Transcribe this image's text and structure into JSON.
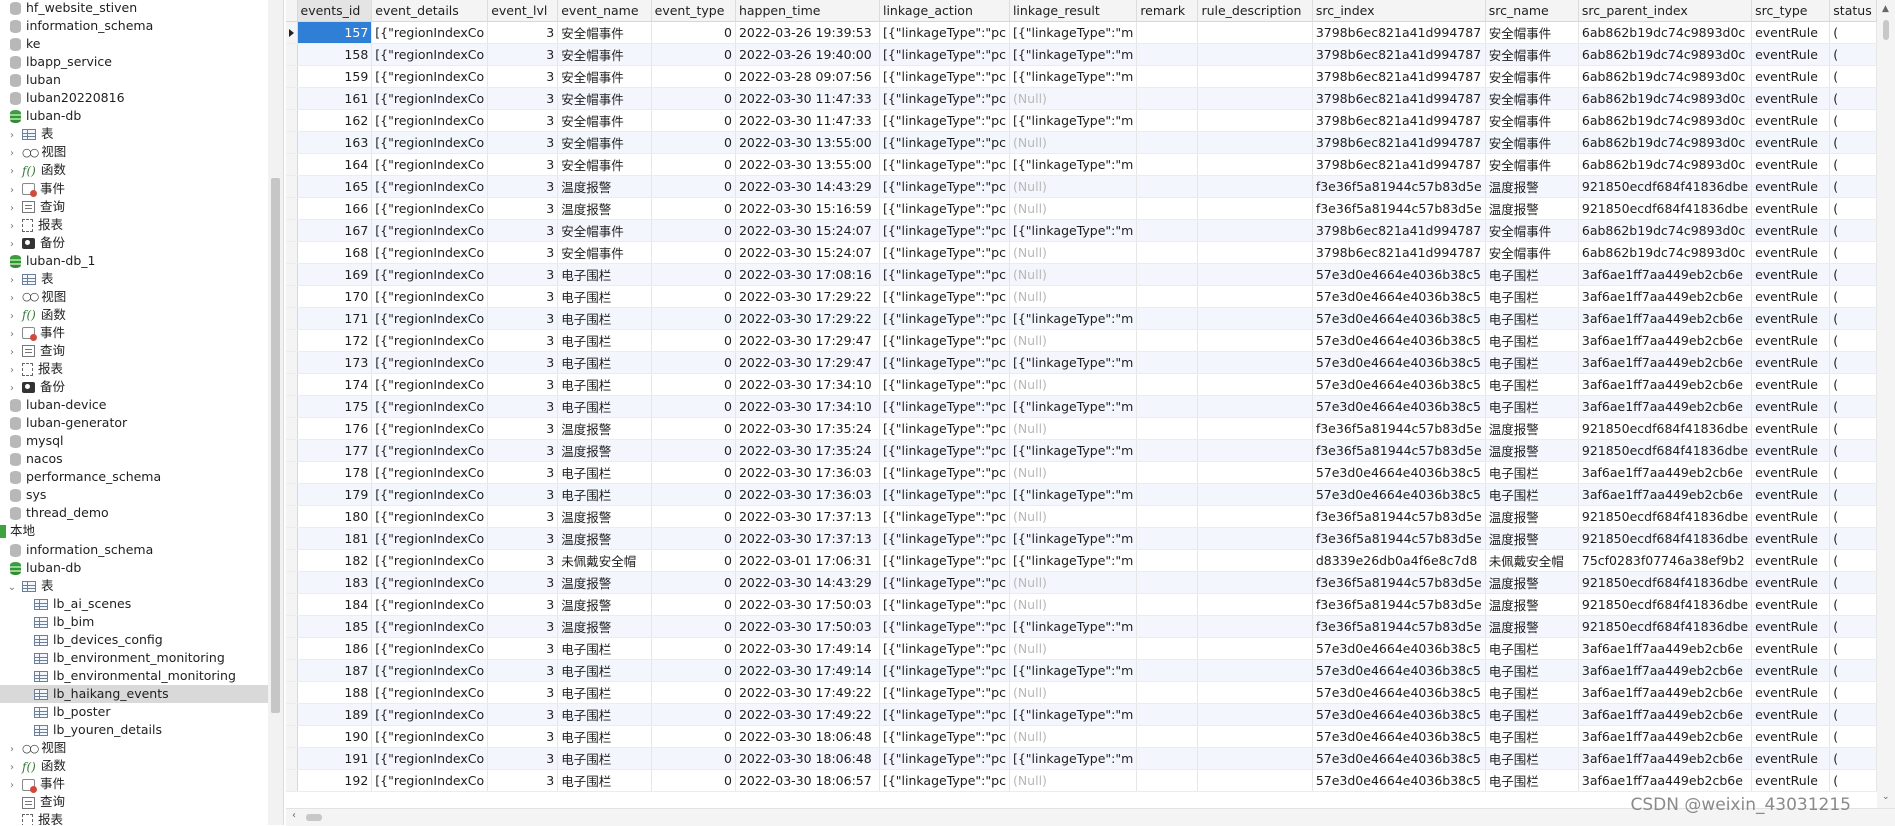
{
  "tree": [
    {
      "label": "hf_website_stiven",
      "icon": "db-gray",
      "depth": 1
    },
    {
      "label": "information_schema",
      "icon": "db-gray",
      "depth": 1
    },
    {
      "label": "ke",
      "icon": "db-gray",
      "depth": 1
    },
    {
      "label": "lbapp_service",
      "icon": "db-gray",
      "depth": 1
    },
    {
      "label": "luban",
      "icon": "db-gray",
      "depth": 1
    },
    {
      "label": "luban20220816",
      "icon": "db-gray",
      "depth": 1
    },
    {
      "label": "luban-db",
      "icon": "db",
      "depth": 1
    },
    {
      "label": "表",
      "icon": "tbl",
      "depth": 2,
      "twisty": "›"
    },
    {
      "label": "视图",
      "icon": "view",
      "depth": 2,
      "twisty": "›"
    },
    {
      "label": "函数",
      "icon": "fx",
      "depth": 2,
      "twisty": "›"
    },
    {
      "label": "事件",
      "icon": "evt",
      "depth": 2,
      "twisty": "›"
    },
    {
      "label": "查询",
      "icon": "qry",
      "depth": 2,
      "twisty": "›"
    },
    {
      "label": "报表",
      "icon": "rpt",
      "depth": 2,
      "twisty": "›"
    },
    {
      "label": "备份",
      "icon": "bak",
      "depth": 2,
      "twisty": "›"
    },
    {
      "label": "luban-db_1",
      "icon": "db",
      "depth": 1
    },
    {
      "label": "表",
      "icon": "tbl",
      "depth": 2,
      "twisty": "›"
    },
    {
      "label": "视图",
      "icon": "view",
      "depth": 2,
      "twisty": "›"
    },
    {
      "label": "函数",
      "icon": "fx",
      "depth": 2,
      "twisty": "›"
    },
    {
      "label": "事件",
      "icon": "evt",
      "depth": 2,
      "twisty": "›"
    },
    {
      "label": "查询",
      "icon": "qry",
      "depth": 2,
      "twisty": "›"
    },
    {
      "label": "报表",
      "icon": "rpt",
      "depth": 2,
      "twisty": "›"
    },
    {
      "label": "备份",
      "icon": "bak",
      "depth": 2,
      "twisty": "›"
    },
    {
      "label": "luban-device",
      "icon": "db-gray",
      "depth": 1
    },
    {
      "label": "luban-generator",
      "icon": "db-gray",
      "depth": 1
    },
    {
      "label": "mysql",
      "icon": "db-gray",
      "depth": 1
    },
    {
      "label": "nacos",
      "icon": "db-gray",
      "depth": 1
    },
    {
      "label": "performance_schema",
      "icon": "db-gray",
      "depth": 1
    },
    {
      "label": "sys",
      "icon": "db-gray",
      "depth": 1
    },
    {
      "label": "thread_demo",
      "icon": "db-gray",
      "depth": 1
    },
    {
      "label": "本地",
      "icon": "conn",
      "depth": 0
    },
    {
      "label": "information_schema",
      "icon": "db-gray",
      "depth": 1
    },
    {
      "label": "luban-db",
      "icon": "db",
      "depth": 1
    },
    {
      "label": "表",
      "icon": "tbl",
      "depth": 2,
      "twisty": "⌄"
    },
    {
      "label": "lb_ai_scenes",
      "icon": "tbl",
      "depth": 3
    },
    {
      "label": "lb_bim",
      "icon": "tbl",
      "depth": 3
    },
    {
      "label": "lb_devices_config",
      "icon": "tbl",
      "depth": 3
    },
    {
      "label": "lb_environment_monitoring",
      "icon": "tbl",
      "depth": 3
    },
    {
      "label": "lb_environmental_monitoring",
      "icon": "tbl",
      "depth": 3
    },
    {
      "label": "lb_haikang_events",
      "icon": "tbl",
      "depth": 3,
      "selected": true
    },
    {
      "label": "lb_poster",
      "icon": "tbl",
      "depth": 3
    },
    {
      "label": "lb_youren_details",
      "icon": "tbl",
      "depth": 3
    },
    {
      "label": "视图",
      "icon": "view",
      "depth": 2,
      "twisty": "›"
    },
    {
      "label": "函数",
      "icon": "fx",
      "depth": 2,
      "twisty": "›"
    },
    {
      "label": "事件",
      "icon": "evt",
      "depth": 2,
      "twisty": "›"
    },
    {
      "label": "查询",
      "icon": "qry",
      "depth": 2
    },
    {
      "label": "报表",
      "icon": "rpt",
      "depth": 2
    }
  ],
  "grid": {
    "columns": [
      "events_id",
      "event_details",
      "event_lvl",
      "event_name",
      "event_type",
      "happen_time",
      "linkage_action",
      "linkage_result",
      "remark",
      "rule_description",
      "src_index",
      "src_name",
      "src_parent_index",
      "src_type",
      "status"
    ],
    "rows": [
      [
        "157",
        "[{\"regionIndexCo",
        "3",
        "安全帽事件",
        "0",
        "2022-03-26 19:39:53",
        "[{\"linkageType\":\"pc",
        "[{\"linkageType\":\"m",
        "",
        "",
        "3798b6ec821a41d994787",
        "安全帽事件",
        "6ab862b19dc74c9893d0c",
        "eventRule",
        "("
      ],
      [
        "158",
        "[{\"regionIndexCo",
        "3",
        "安全帽事件",
        "0",
        "2022-03-26 19:40:00",
        "[{\"linkageType\":\"pc",
        "[{\"linkageType\":\"m",
        "",
        "",
        "3798b6ec821a41d994787",
        "安全帽事件",
        "6ab862b19dc74c9893d0c",
        "eventRule",
        "("
      ],
      [
        "159",
        "[{\"regionIndexCo",
        "3",
        "安全帽事件",
        "0",
        "2022-03-28 09:07:56",
        "[{\"linkageType\":\"pc",
        "[{\"linkageType\":\"m",
        "",
        "",
        "3798b6ec821a41d994787",
        "安全帽事件",
        "6ab862b19dc74c9893d0c",
        "eventRule",
        "("
      ],
      [
        "161",
        "[{\"regionIndexCo",
        "3",
        "安全帽事件",
        "0",
        "2022-03-30 11:47:33",
        "[{\"linkageType\":\"pc",
        "(Null)",
        "",
        "",
        "3798b6ec821a41d994787",
        "安全帽事件",
        "6ab862b19dc74c9893d0c",
        "eventRule",
        "("
      ],
      [
        "162",
        "[{\"regionIndexCo",
        "3",
        "安全帽事件",
        "0",
        "2022-03-30 11:47:33",
        "[{\"linkageType\":\"pc",
        "[{\"linkageType\":\"m",
        "",
        "",
        "3798b6ec821a41d994787",
        "安全帽事件",
        "6ab862b19dc74c9893d0c",
        "eventRule",
        "("
      ],
      [
        "163",
        "[{\"regionIndexCo",
        "3",
        "安全帽事件",
        "0",
        "2022-03-30 13:55:00",
        "[{\"linkageType\":\"pc",
        "(Null)",
        "",
        "",
        "3798b6ec821a41d994787",
        "安全帽事件",
        "6ab862b19dc74c9893d0c",
        "eventRule",
        "("
      ],
      [
        "164",
        "[{\"regionIndexCo",
        "3",
        "安全帽事件",
        "0",
        "2022-03-30 13:55:00",
        "[{\"linkageType\":\"pc",
        "[{\"linkageType\":\"m",
        "",
        "",
        "3798b6ec821a41d994787",
        "安全帽事件",
        "6ab862b19dc74c9893d0c",
        "eventRule",
        "("
      ],
      [
        "165",
        "[{\"regionIndexCo",
        "3",
        "温度报警",
        "0",
        "2022-03-30 14:43:29",
        "[{\"linkageType\":\"pc",
        "(Null)",
        "",
        "",
        "f3e36f5a81944c57b83d5e",
        "温度报警",
        "921850ecdf684f41836dbe",
        "eventRule",
        "("
      ],
      [
        "166",
        "[{\"regionIndexCo",
        "3",
        "温度报警",
        "0",
        "2022-03-30 15:16:59",
        "[{\"linkageType\":\"pc",
        "(Null)",
        "",
        "",
        "f3e36f5a81944c57b83d5e",
        "温度报警",
        "921850ecdf684f41836dbe",
        "eventRule",
        "("
      ],
      [
        "167",
        "[{\"regionIndexCo",
        "3",
        "安全帽事件",
        "0",
        "2022-03-30 15:24:07",
        "[{\"linkageType\":\"pc",
        "[{\"linkageType\":\"m",
        "",
        "",
        "3798b6ec821a41d994787",
        "安全帽事件",
        "6ab862b19dc74c9893d0c",
        "eventRule",
        "("
      ],
      [
        "168",
        "[{\"regionIndexCo",
        "3",
        "安全帽事件",
        "0",
        "2022-03-30 15:24:07",
        "[{\"linkageType\":\"pc",
        "(Null)",
        "",
        "",
        "3798b6ec821a41d994787",
        "安全帽事件",
        "6ab862b19dc74c9893d0c",
        "eventRule",
        "("
      ],
      [
        "169",
        "[{\"regionIndexCo",
        "3",
        "电子围栏",
        "0",
        "2022-03-30 17:08:16",
        "[{\"linkageType\":\"pc",
        "(Null)",
        "",
        "",
        "57e3d0e4664e4036b38c5",
        "电子围栏",
        "3af6ae1ff7aa449eb2cb6e",
        "eventRule",
        "("
      ],
      [
        "170",
        "[{\"regionIndexCo",
        "3",
        "电子围栏",
        "0",
        "2022-03-30 17:29:22",
        "[{\"linkageType\":\"pc",
        "(Null)",
        "",
        "",
        "57e3d0e4664e4036b38c5",
        "电子围栏",
        "3af6ae1ff7aa449eb2cb6e",
        "eventRule",
        "("
      ],
      [
        "171",
        "[{\"regionIndexCo",
        "3",
        "电子围栏",
        "0",
        "2022-03-30 17:29:22",
        "[{\"linkageType\":\"pc",
        "[{\"linkageType\":\"m",
        "",
        "",
        "57e3d0e4664e4036b38c5",
        "电子围栏",
        "3af6ae1ff7aa449eb2cb6e",
        "eventRule",
        "("
      ],
      [
        "172",
        "[{\"regionIndexCo",
        "3",
        "电子围栏",
        "0",
        "2022-03-30 17:29:47",
        "[{\"linkageType\":\"pc",
        "(Null)",
        "",
        "",
        "57e3d0e4664e4036b38c5",
        "电子围栏",
        "3af6ae1ff7aa449eb2cb6e",
        "eventRule",
        "("
      ],
      [
        "173",
        "[{\"regionIndexCo",
        "3",
        "电子围栏",
        "0",
        "2022-03-30 17:29:47",
        "[{\"linkageType\":\"pc",
        "[{\"linkageType\":\"m",
        "",
        "",
        "57e3d0e4664e4036b38c5",
        "电子围栏",
        "3af6ae1ff7aa449eb2cb6e",
        "eventRule",
        "("
      ],
      [
        "174",
        "[{\"regionIndexCo",
        "3",
        "电子围栏",
        "0",
        "2022-03-30 17:34:10",
        "[{\"linkageType\":\"pc",
        "(Null)",
        "",
        "",
        "57e3d0e4664e4036b38c5",
        "电子围栏",
        "3af6ae1ff7aa449eb2cb6e",
        "eventRule",
        "("
      ],
      [
        "175",
        "[{\"regionIndexCo",
        "3",
        "电子围栏",
        "0",
        "2022-03-30 17:34:10",
        "[{\"linkageType\":\"pc",
        "[{\"linkageType\":\"m",
        "",
        "",
        "57e3d0e4664e4036b38c5",
        "电子围栏",
        "3af6ae1ff7aa449eb2cb6e",
        "eventRule",
        "("
      ],
      [
        "176",
        "[{\"regionIndexCo",
        "3",
        "温度报警",
        "0",
        "2022-03-30 17:35:24",
        "[{\"linkageType\":\"pc",
        "(Null)",
        "",
        "",
        "f3e36f5a81944c57b83d5e",
        "温度报警",
        "921850ecdf684f41836dbe",
        "eventRule",
        "("
      ],
      [
        "177",
        "[{\"regionIndexCo",
        "3",
        "温度报警",
        "0",
        "2022-03-30 17:35:24",
        "[{\"linkageType\":\"pc",
        "[{\"linkageType\":\"m",
        "",
        "",
        "f3e36f5a81944c57b83d5e",
        "温度报警",
        "921850ecdf684f41836dbe",
        "eventRule",
        "("
      ],
      [
        "178",
        "[{\"regionIndexCo",
        "3",
        "电子围栏",
        "0",
        "2022-03-30 17:36:03",
        "[{\"linkageType\":\"pc",
        "(Null)",
        "",
        "",
        "57e3d0e4664e4036b38c5",
        "电子围栏",
        "3af6ae1ff7aa449eb2cb6e",
        "eventRule",
        "("
      ],
      [
        "179",
        "[{\"regionIndexCo",
        "3",
        "电子围栏",
        "0",
        "2022-03-30 17:36:03",
        "[{\"linkageType\":\"pc",
        "[{\"linkageType\":\"m",
        "",
        "",
        "57e3d0e4664e4036b38c5",
        "电子围栏",
        "3af6ae1ff7aa449eb2cb6e",
        "eventRule",
        "("
      ],
      [
        "180",
        "[{\"regionIndexCo",
        "3",
        "温度报警",
        "0",
        "2022-03-30 17:37:13",
        "[{\"linkageType\":\"pc",
        "(Null)",
        "",
        "",
        "f3e36f5a81944c57b83d5e",
        "温度报警",
        "921850ecdf684f41836dbe",
        "eventRule",
        "("
      ],
      [
        "181",
        "[{\"regionIndexCo",
        "3",
        "温度报警",
        "0",
        "2022-03-30 17:37:13",
        "[{\"linkageType\":\"pc",
        "[{\"linkageType\":\"m",
        "",
        "",
        "f3e36f5a81944c57b83d5e",
        "温度报警",
        "921850ecdf684f41836dbe",
        "eventRule",
        "("
      ],
      [
        "182",
        "[{\"regionIndexCo",
        "3",
        "未佩戴安全帽",
        "0",
        "2022-03-01 17:06:31",
        "[{\"linkageType\":\"pc",
        "[{\"linkageType\":\"m",
        "",
        "",
        "d8339e26db0a4f6e8c7d8",
        "未佩戴安全帽",
        "75cf0283f07746a38ef9b2",
        "eventRule",
        "("
      ],
      [
        "183",
        "[{\"regionIndexCo",
        "3",
        "温度报警",
        "0",
        "2022-03-30 14:43:29",
        "[{\"linkageType\":\"pc",
        "(Null)",
        "",
        "",
        "f3e36f5a81944c57b83d5e",
        "温度报警",
        "921850ecdf684f41836dbe",
        "eventRule",
        "("
      ],
      [
        "184",
        "[{\"regionIndexCo",
        "3",
        "温度报警",
        "0",
        "2022-03-30 17:50:03",
        "[{\"linkageType\":\"pc",
        "(Null)",
        "",
        "",
        "f3e36f5a81944c57b83d5e",
        "温度报警",
        "921850ecdf684f41836dbe",
        "eventRule",
        "("
      ],
      [
        "185",
        "[{\"regionIndexCo",
        "3",
        "温度报警",
        "0",
        "2022-03-30 17:50:03",
        "[{\"linkageType\":\"pc",
        "[{\"linkageType\":\"m",
        "",
        "",
        "f3e36f5a81944c57b83d5e",
        "温度报警",
        "921850ecdf684f41836dbe",
        "eventRule",
        "("
      ],
      [
        "186",
        "[{\"regionIndexCo",
        "3",
        "电子围栏",
        "0",
        "2022-03-30 17:49:14",
        "[{\"linkageType\":\"pc",
        "(Null)",
        "",
        "",
        "57e3d0e4664e4036b38c5",
        "电子围栏",
        "3af6ae1ff7aa449eb2cb6e",
        "eventRule",
        "("
      ],
      [
        "187",
        "[{\"regionIndexCo",
        "3",
        "电子围栏",
        "0",
        "2022-03-30 17:49:14",
        "[{\"linkageType\":\"pc",
        "[{\"linkageType\":\"m",
        "",
        "",
        "57e3d0e4664e4036b38c5",
        "电子围栏",
        "3af6ae1ff7aa449eb2cb6e",
        "eventRule",
        "("
      ],
      [
        "188",
        "[{\"regionIndexCo",
        "3",
        "电子围栏",
        "0",
        "2022-03-30 17:49:22",
        "[{\"linkageType\":\"pc",
        "(Null)",
        "",
        "",
        "57e3d0e4664e4036b38c5",
        "电子围栏",
        "3af6ae1ff7aa449eb2cb6e",
        "eventRule",
        "("
      ],
      [
        "189",
        "[{\"regionIndexCo",
        "3",
        "电子围栏",
        "0",
        "2022-03-30 17:49:22",
        "[{\"linkageType\":\"pc",
        "[{\"linkageType\":\"m",
        "",
        "",
        "57e3d0e4664e4036b38c5",
        "电子围栏",
        "3af6ae1ff7aa449eb2cb6e",
        "eventRule",
        "("
      ],
      [
        "190",
        "[{\"regionIndexCo",
        "3",
        "电子围栏",
        "0",
        "2022-03-30 18:06:48",
        "[{\"linkageType\":\"pc",
        "(Null)",
        "",
        "",
        "57e3d0e4664e4036b38c5",
        "电子围栏",
        "3af6ae1ff7aa449eb2cb6e",
        "eventRule",
        "("
      ],
      [
        "191",
        "[{\"regionIndexCo",
        "3",
        "电子围栏",
        "0",
        "2022-03-30 18:06:48",
        "[{\"linkageType\":\"pc",
        "[{\"linkageType\":\"m",
        "",
        "",
        "57e3d0e4664e4036b38c5",
        "电子围栏",
        "3af6ae1ff7aa449eb2cb6e",
        "eventRule",
        "("
      ],
      [
        "192",
        "[{\"regionIndexCo",
        "3",
        "电子围栏",
        "0",
        "2022-03-30 18:06:57",
        "[{\"linkageType\":\"pc",
        "(Null)",
        "",
        "",
        "57e3d0e4664e4036b38c5",
        "电子围栏",
        "3af6ae1ff7aa449eb2cb6e",
        "eventRule",
        "("
      ]
    ],
    "selected_row": 0,
    "null_text": "(Null)"
  },
  "watermark": "CSDN @weixin_43031215"
}
